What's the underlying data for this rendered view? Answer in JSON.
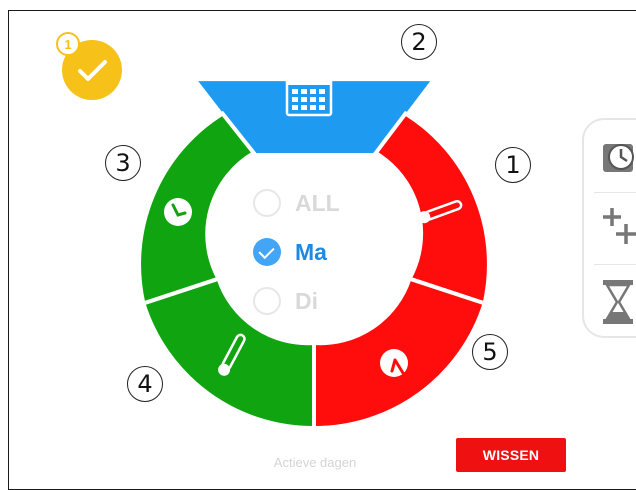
{
  "badge": {
    "count": "1",
    "icon": "check-icon"
  },
  "callouts": [
    "1",
    "2",
    "3",
    "4",
    "5"
  ],
  "dial": {
    "segments": [
      {
        "id": "calendar",
        "color": "#1e9bf0",
        "icon": "calendar-icon"
      },
      {
        "id": "temperature-top",
        "color": "#ff0d0d",
        "icon": "thermometer-icon"
      },
      {
        "id": "timer-bottom-right",
        "color": "#ff0d0d",
        "icon": "clock-icon"
      },
      {
        "id": "temperature-left",
        "color": "#10a510",
        "icon": "thermometer-icon"
      },
      {
        "id": "timer-left",
        "color": "#10a510",
        "icon": "clock-icon"
      }
    ]
  },
  "days": [
    {
      "label": "ALL",
      "checked": false
    },
    {
      "label": "Ma",
      "checked": true
    },
    {
      "label": "Di",
      "checked": false
    }
  ],
  "side_panel": {
    "icons": [
      "clock-icon",
      "add-icon",
      "hourglass-icon"
    ]
  },
  "footer": {
    "active_days_label": "Actieve dagen",
    "clear_button": "WISSEN"
  },
  "colors": {
    "blue": "#1e9bf0",
    "red": "#ff0d0d",
    "green": "#10a510",
    "yellow": "#f6c21a",
    "accent": "#1e88e5"
  }
}
